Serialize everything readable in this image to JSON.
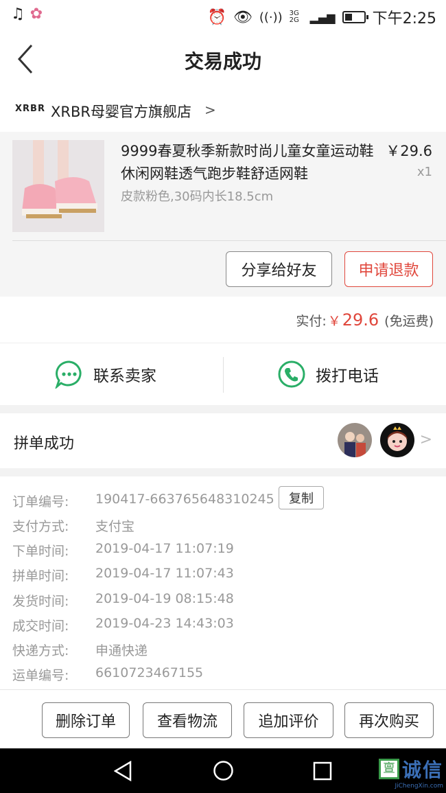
{
  "status_bar": {
    "time": "下午2:25",
    "network": "3G 2G"
  },
  "header": {
    "title": "交易成功"
  },
  "shop": {
    "logo_text": "XRBR",
    "name": "XRBR母婴官方旗舰店",
    "chevron": ">"
  },
  "product": {
    "title": "9999春夏秋季新款时尚儿童女童运动鞋休闲网鞋透气跑步鞋舒适网鞋",
    "spec": "皮款粉色,30码内长18.5cm",
    "price": "￥29.6",
    "qty": "x1",
    "share_label": "分享给好友",
    "refund_label": "申请退款"
  },
  "payment": {
    "label": "实付:",
    "currency": "￥",
    "amount": "29.6",
    "shipping_note": "(免运费)"
  },
  "contact": {
    "seller_label": "联系卖家",
    "phone_label": "拨打电话"
  },
  "group": {
    "label": "拼单成功"
  },
  "order_info": {
    "copy_label": "复制",
    "rows": [
      {
        "label": "订单编号:",
        "value": "190417-663765648310245"
      },
      {
        "label": "支付方式:",
        "value": "支付宝"
      },
      {
        "label": "下单时间:",
        "value": "2019-04-17 11:07:19"
      },
      {
        "label": "拼单时间:",
        "value": "2019-04-17 11:07:43"
      },
      {
        "label": "发货时间:",
        "value": "2019-04-19 08:15:48"
      },
      {
        "label": "成交时间:",
        "value": "2019-04-23 14:43:03"
      },
      {
        "label": "快递方式:",
        "value": "申通快递"
      },
      {
        "label": "运单编号:",
        "value": "6610723467155"
      }
    ]
  },
  "actions": {
    "delete": "删除订单",
    "logistics": "查看物流",
    "review": "追加评价",
    "rebuy": "再次购买"
  },
  "watermark": {
    "text": "诚信",
    "sub": "JiChengXin.com"
  },
  "colors": {
    "accent_red": "#e0473c",
    "wechat_green": "#2aae67"
  }
}
